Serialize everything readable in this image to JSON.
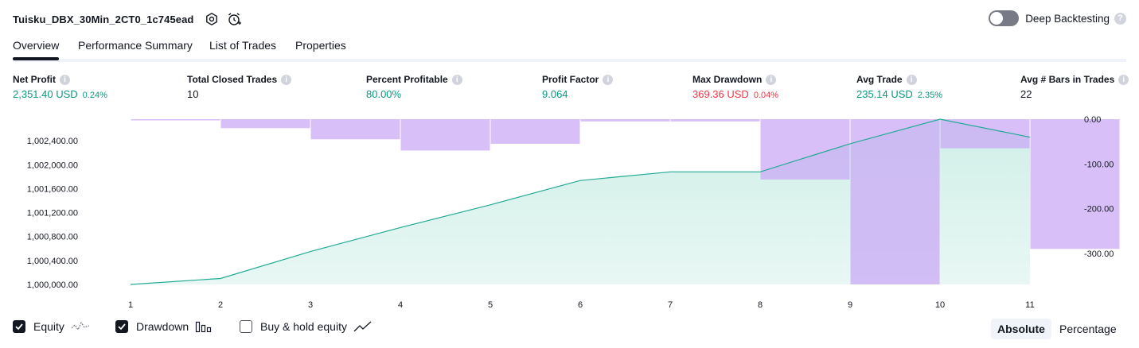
{
  "header": {
    "strategy_name": "Tuisku_DBX_30Min_2CT0_1c745ead",
    "deep_backtesting_label": "Deep Backtesting"
  },
  "tabs": [
    {
      "label": "Overview",
      "active": true
    },
    {
      "label": "Performance Summary",
      "active": false
    },
    {
      "label": "List of Trades",
      "active": false
    },
    {
      "label": "Properties",
      "active": false
    }
  ],
  "metrics": [
    {
      "label": "Net Profit",
      "value": "2,351.40 USD",
      "pct": "0.24%",
      "color": "green"
    },
    {
      "label": "Total Closed Trades",
      "value": "10",
      "pct": "",
      "color": "dark"
    },
    {
      "label": "Percent Profitable",
      "value": "80.00%",
      "pct": "",
      "color": "green"
    },
    {
      "label": "Profit Factor",
      "value": "9.064",
      "pct": "",
      "color": "green"
    },
    {
      "label": "Max Drawdown",
      "value": "369.36 USD",
      "pct": "0.04%",
      "color": "red"
    },
    {
      "label": "Avg Trade",
      "value": "235.14 USD",
      "pct": "2.35%",
      "color": "green"
    },
    {
      "label": "Avg # Bars in Trades",
      "value": "22",
      "pct": "",
      "color": "dark"
    }
  ],
  "chart_data": {
    "type": "line",
    "x": [
      1,
      2,
      3,
      4,
      5,
      6,
      7,
      8,
      9,
      10,
      11
    ],
    "x_tick_labels": [
      "1",
      "2",
      "3",
      "4",
      "5",
      "6",
      "7",
      "8",
      "9",
      "10",
      "11"
    ],
    "series": [
      {
        "name": "Equity",
        "kind": "area",
        "axis": "left",
        "values": [
          1000000.0,
          1000100.0,
          1000550.0,
          1000950.0,
          1001330.0,
          1001735.0,
          1001880.0,
          1001880.0,
          1002350.0,
          1002760.0,
          1002460.0
        ]
      },
      {
        "name": "Drawdown",
        "kind": "bar",
        "axis": "right",
        "values": [
          -2,
          -20,
          -45,
          -70,
          -55,
          -5,
          -5,
          -135,
          -369.36,
          -65,
          -290
        ]
      }
    ],
    "y_left": {
      "ticks": [
        "1,000,000.00",
        "1,000,400.00",
        "1,000,800.00",
        "1,001,200.00",
        "1,001,600.00",
        "1,002,000.00",
        "1,002,400.00"
      ],
      "range": [
        1000000,
        1002760
      ]
    },
    "y_right": {
      "ticks": [
        "0.00",
        "-100.00",
        "-200.00",
        "-300.00"
      ],
      "range": [
        0,
        -369.36
      ]
    },
    "colors": {
      "equity_line": "#22ab94",
      "equity_fill": "#cdeee6",
      "drawdown_bar": "#c9a6f5"
    },
    "grid": false
  },
  "legend": [
    {
      "label": "Equity",
      "checked": true,
      "icon": "equity-wave-icon"
    },
    {
      "label": "Drawdown",
      "checked": true,
      "icon": "drawdown-bars-icon"
    },
    {
      "label": "Buy & hold equity",
      "checked": false,
      "icon": "buy-hold-line-icon"
    }
  ],
  "scale_options": {
    "absolute": "Absolute",
    "percentage": "Percentage"
  }
}
